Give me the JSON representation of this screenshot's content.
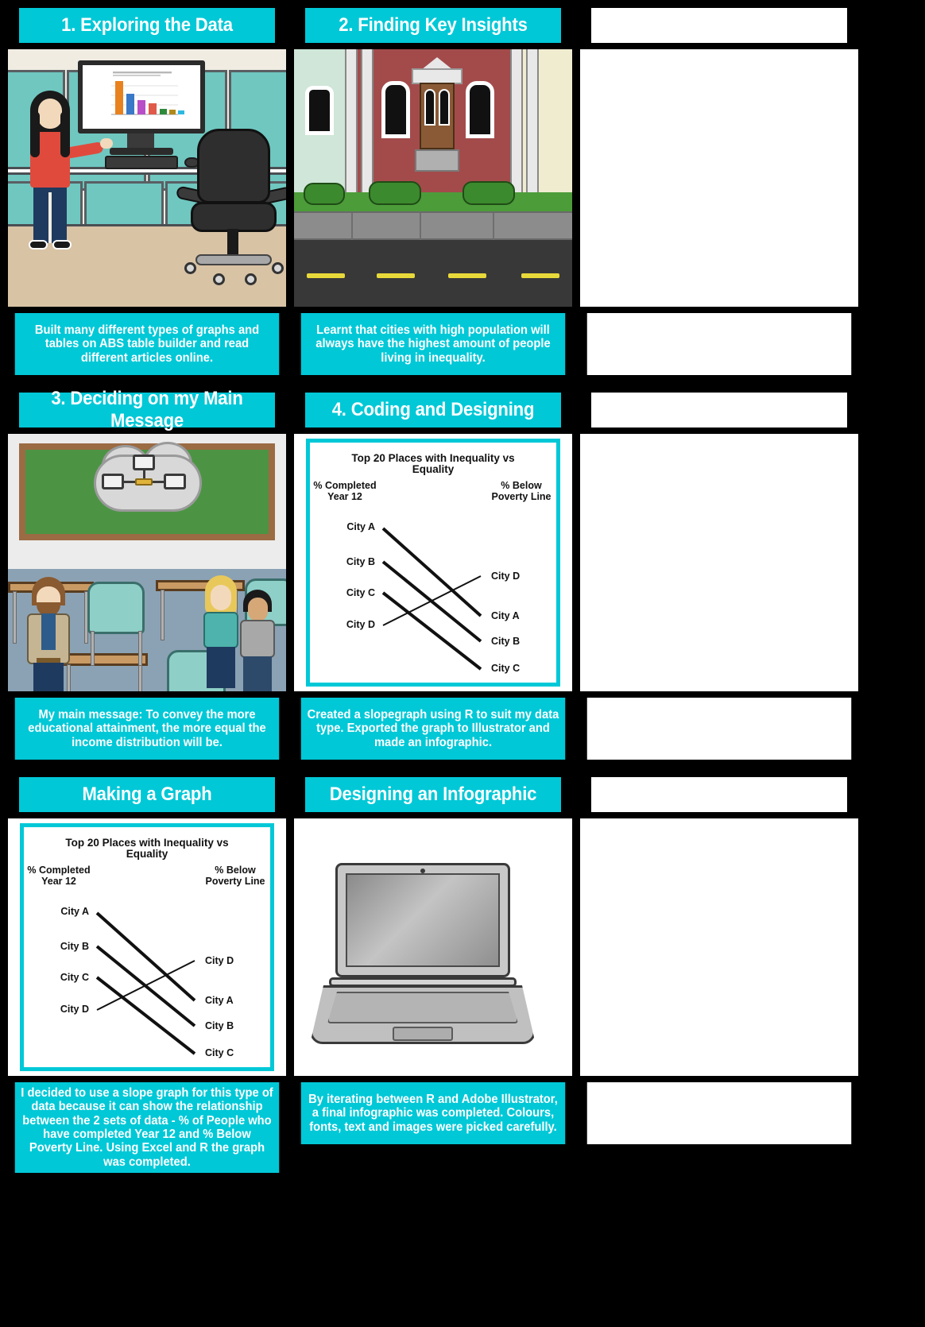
{
  "board": {
    "background_color": "#000000",
    "accent_color": "#00c8d7",
    "text_color": "#ffffff"
  },
  "panels": [
    {
      "id": "panel-1",
      "title": "1. Exploring the Data",
      "scene": "office-presentation",
      "caption": "Built many different types of graphs and tables on ABS table builder and read different articles online."
    },
    {
      "id": "panel-2",
      "title": "2. Finding Key Insights",
      "scene": "house-street",
      "caption": "Learnt that cities with high population will always have the highest amount of people living in inequality."
    },
    {
      "id": "panel-3",
      "title": "",
      "scene": "blank",
      "caption": ""
    },
    {
      "id": "panel-4",
      "title": "3. Deciding on my Main Message",
      "scene": "classroom",
      "caption": "My main message: To convey the more educational attainment, the more equal the income distribution will be."
    },
    {
      "id": "panel-5",
      "title": "4. Coding and Designing",
      "scene": "slopegraph",
      "caption": "Created a slopegraph using R to suit my data type. Exported the graph to Illustrator and made an infographic."
    },
    {
      "id": "panel-6",
      "title": "",
      "scene": "blank",
      "caption": ""
    },
    {
      "id": "panel-7",
      "title": "Making a Graph",
      "scene": "slopegraph",
      "caption": "I decided to use a slope graph for this type of data because it can show the relationship between the 2 sets of data - % of People who have completed Year 12 and % Below Poverty Line. Using Excel and R the graph was completed."
    },
    {
      "id": "panel-8",
      "title": "Designing an Infographic",
      "scene": "laptop",
      "caption": "By iterating between R and Adobe Illustrator, a final infographic was completed. Colours, fonts, text and images were picked carefully."
    },
    {
      "id": "panel-9",
      "title": "",
      "scene": "blank",
      "caption": ""
    }
  ],
  "chart_data": {
    "type": "line",
    "chart_subtype": "slopegraph",
    "title": "Top 20 Places with Inequality vs Equality",
    "left_axis_label": "% Completed Year 12",
    "right_axis_label": "% Below Poverty Line",
    "left_labels": [
      "City A",
      "City B",
      "City C",
      "City D"
    ],
    "right_labels": [
      "City D",
      "City A",
      "City B",
      "City C"
    ],
    "categories": [
      "City A",
      "City B",
      "City C",
      "City D"
    ],
    "series": [
      {
        "name": "City A",
        "left_rank": 1,
        "right_rank": 2,
        "left_y": 1,
        "right_y": 2,
        "stroke_width": 4
      },
      {
        "name": "City B",
        "left_rank": 2,
        "right_rank": 3,
        "left_y": 2,
        "right_y": 3,
        "stroke_width": 4
      },
      {
        "name": "City C",
        "left_rank": 3,
        "right_rank": 4,
        "left_y": 3,
        "right_y": 4,
        "stroke_width": 4
      },
      {
        "name": "City D",
        "left_rank": 4,
        "right_rank": 1,
        "left_y": 4,
        "right_y": 1,
        "stroke_width": 2
      }
    ],
    "xlabel": "",
    "ylabel": "",
    "grid": false,
    "legend": "none",
    "note": "Left column ordered City A (top) to City D (bottom); right column ordered City D (top), City A, City B, City C (bottom)."
  },
  "icons": {
    "monitor": "monitor-icon",
    "keyboard": "keyboard-icon",
    "mouse": "mouse-icon",
    "office_chair": "office-chair-icon",
    "chalkboard": "chalkboard-icon",
    "network_cloud": "cloud-network-icon",
    "laptop": "laptop-icon",
    "house": "house-icon"
  }
}
